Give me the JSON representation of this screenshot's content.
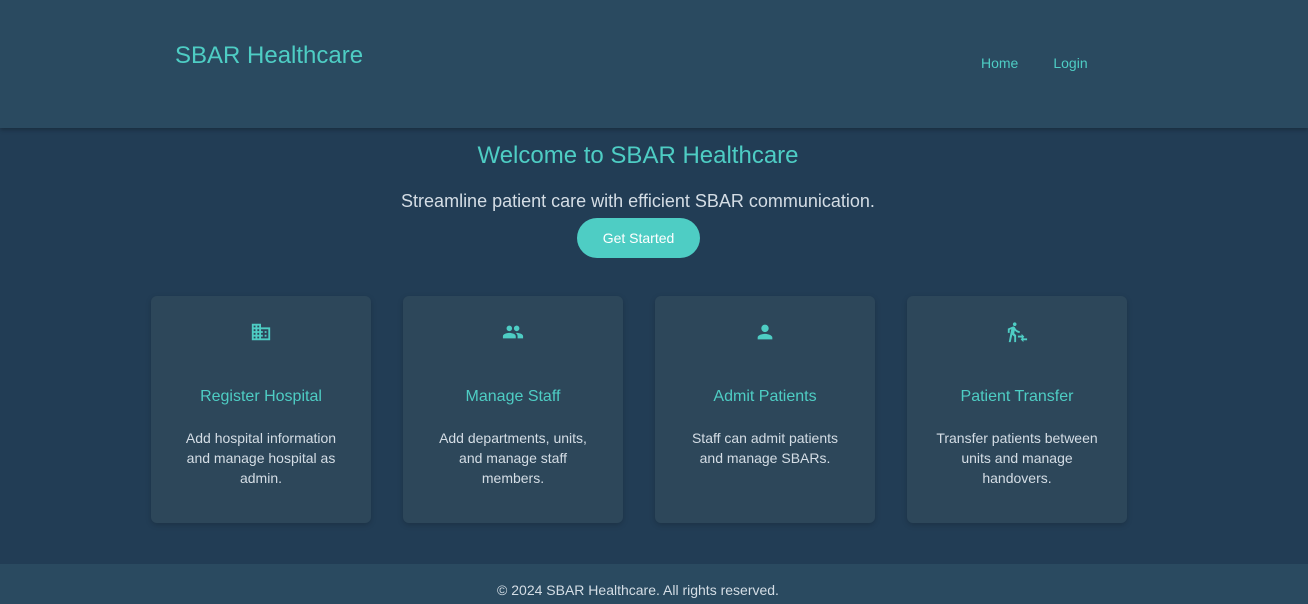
{
  "header": {
    "brand": "SBAR Healthcare",
    "nav": [
      {
        "label": "Home"
      },
      {
        "label": "Login"
      }
    ]
  },
  "hero": {
    "title": "Welcome to SBAR Healthcare",
    "subtitle": "Streamline patient care with efficient SBAR communication.",
    "cta_label": "Get Started"
  },
  "features": [
    {
      "icon": "hospital-building-icon",
      "title": "Register Hospital",
      "description": "Add hospital information and manage hospital as admin."
    },
    {
      "icon": "people-group-icon",
      "title": "Manage Staff",
      "description": "Add departments, units, and manage staff members."
    },
    {
      "icon": "person-icon",
      "title": "Admit Patients",
      "description": "Staff can admit patients and manage SBARs."
    },
    {
      "icon": "patient-transfer-icon",
      "title": "Patient Transfer",
      "description": "Transfer patients between units and manage handovers."
    }
  ],
  "footer": {
    "copyright": "© 2024 SBAR Healthcare. All rights reserved."
  },
  "colors": {
    "accent": "#4ecdc4",
    "background": "#223d55",
    "header_bg": "#2a4a60",
    "card_bg": "#2d475a",
    "text_light": "#d4dde5"
  }
}
